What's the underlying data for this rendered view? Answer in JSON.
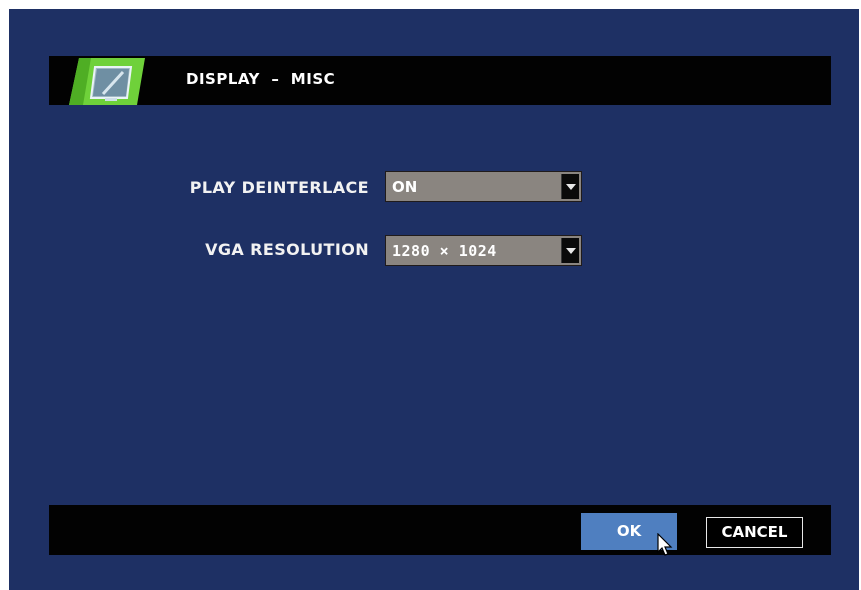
{
  "header": {
    "title": "DISPLAY  –  MISC",
    "icon": "display-monitor-icon"
  },
  "settings": {
    "play_deinterlace": {
      "label": "PLAY DEINTERLACE",
      "value": "ON"
    },
    "vga_resolution": {
      "label": "VGA RESOLUTION",
      "value": "1280 × 1024"
    }
  },
  "footer": {
    "ok_label": "OK",
    "cancel_label": "CANCEL"
  },
  "colors": {
    "background": "#1e3064",
    "bars": "#020202",
    "ok_button": "#4f7fc0",
    "select_box": "#8a8580",
    "icon_green": "#6fd13a"
  }
}
